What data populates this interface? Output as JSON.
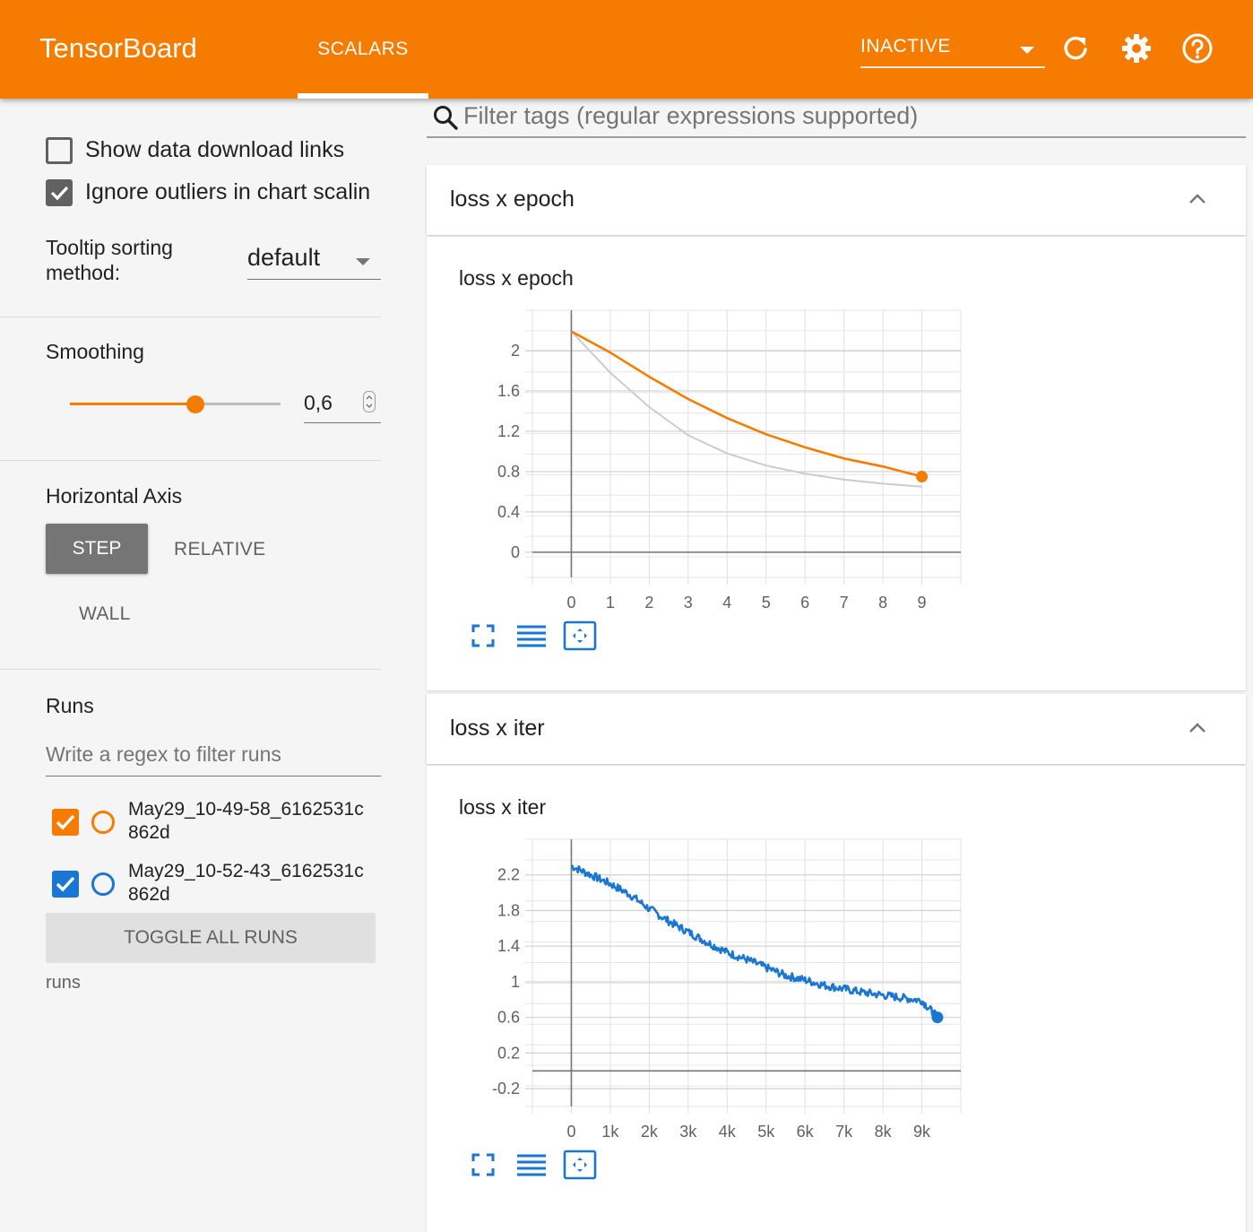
{
  "header": {
    "brand": "TensorBoard",
    "tab": "SCALARS",
    "status": "INACTIVE",
    "icons": [
      "refresh-icon",
      "gear-icon",
      "help-icon"
    ],
    "accent": "#f57c00"
  },
  "sidebar": {
    "show_download": {
      "label": "Show data download links",
      "checked": false
    },
    "ignore_outliers": {
      "label": "Ignore outliers in chart scalin",
      "checked": true
    },
    "tooltip_sorting": {
      "label": "Tooltip sorting method:",
      "value": "default"
    },
    "smoothing": {
      "label": "Smoothing",
      "value": "0,6",
      "level": 0.6
    },
    "horizontal_axis": {
      "label": "Horizontal Axis",
      "options": [
        "STEP",
        "RELATIVE",
        "WALL"
      ],
      "selected": "STEP"
    },
    "runs": {
      "label": "Runs",
      "filter_placeholder": "Write a regex to filter runs",
      "items": [
        {
          "name": "May29_10-49-58_6162531c",
          "name2": "862d",
          "color": "#f57c00",
          "checked": true
        },
        {
          "name": "May29_10-52-43_6162531c",
          "name2": "862d",
          "color": "#1976d2",
          "checked": true
        }
      ],
      "toggle_all": "TOGGLE ALL RUNS",
      "footer": "runs"
    }
  },
  "main": {
    "filter_placeholder": "Filter tags (regular expressions supported)",
    "cards": [
      {
        "header": "loss x epoch",
        "chart_title": "loss x epoch"
      },
      {
        "header": "loss x iter",
        "chart_title": "loss x iter"
      }
    ]
  },
  "chart_data": [
    {
      "type": "line",
      "title": "loss x epoch",
      "x": [
        0,
        1,
        2,
        3,
        4,
        5,
        6,
        7,
        8,
        9
      ],
      "xticks": [
        "0",
        "1",
        "2",
        "3",
        "4",
        "5",
        "6",
        "7",
        "8",
        "9"
      ],
      "yticks": [
        "2",
        "1.6",
        "1.2",
        "0.8",
        "0.4",
        "0"
      ],
      "xlim": [
        -1,
        10
      ],
      "ylim": [
        -0.25,
        2.4
      ],
      "series": [
        {
          "values": [
            2.19,
            1.98,
            1.74,
            1.52,
            1.33,
            1.17,
            1.04,
            0.93,
            0.85,
            0.75
          ],
          "color": "#f57c00"
        },
        {
          "values": [
            2.19,
            1.78,
            1.44,
            1.16,
            0.98,
            0.86,
            0.78,
            0.72,
            0.68,
            0.65
          ],
          "color": "#cccccc"
        }
      ]
    },
    {
      "type": "line",
      "title": "loss x iter",
      "x": [
        0,
        500,
        1000,
        1500,
        2000,
        2500,
        3000,
        3500,
        4000,
        4500,
        5000,
        5500,
        6000,
        6500,
        7000,
        7500,
        8000,
        8500,
        9000,
        9400
      ],
      "xticks": [
        "0",
        "1k",
        "2k",
        "3k",
        "4k",
        "5k",
        "6k",
        "7k",
        "8k",
        "9k"
      ],
      "yticks": [
        "2.2",
        "1.8",
        "1.4",
        "1",
        "0.6",
        "0.2",
        "-0.2"
      ],
      "xlim": [
        -1000,
        10000
      ],
      "ylim": [
        -0.4,
        2.6
      ],
      "series": [
        {
          "values": [
            2.3,
            2.2,
            2.1,
            1.98,
            1.82,
            1.68,
            1.56,
            1.44,
            1.33,
            1.25,
            1.16,
            1.07,
            1.02,
            0.96,
            0.92,
            0.88,
            0.85,
            0.82,
            0.79,
            0.6
          ],
          "color": "#1976d2"
        }
      ]
    }
  ]
}
